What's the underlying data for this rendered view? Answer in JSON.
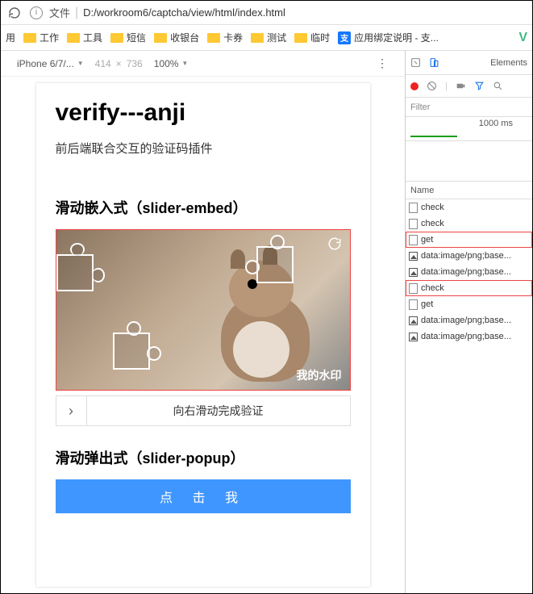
{
  "browser": {
    "url_label": "文件",
    "url_path": "D:/workroom6/captcha/view/html/index.html"
  },
  "bookmarks": {
    "b0": "用",
    "b1": "工作",
    "b2": "工具",
    "b3": "短信",
    "b4": "收银台",
    "b5": "卡券",
    "b6": "测试",
    "b7": "临时",
    "b8": "应用绑定说明 - 支..."
  },
  "device_toolbar": {
    "device": "iPhone 6/7/...",
    "width": "414",
    "height": "736",
    "zoom": "100%"
  },
  "page": {
    "title": "verify---anji",
    "subtitle": "前后端联合交互的验证码插件",
    "section1": "滑动嵌入式（slider-embed）",
    "slider_text": "向右滑动完成验证",
    "watermark": "我的水印",
    "section2": "滑动弹出式（slider-popup）",
    "popup_btn": "点 击 我"
  },
  "devtools": {
    "tab_elements": "Elements",
    "filter": "Filter",
    "timeline_label": "1000 ms",
    "name_header": "Name",
    "rows": {
      "r0": "check",
      "r1": "check",
      "r2": "get",
      "r3": "data:image/png;base...",
      "r4": "data:image/png;base...",
      "r5": "check",
      "r6": "get",
      "r7": "data:image/png;base...",
      "r8": "data:image/png;base..."
    }
  }
}
